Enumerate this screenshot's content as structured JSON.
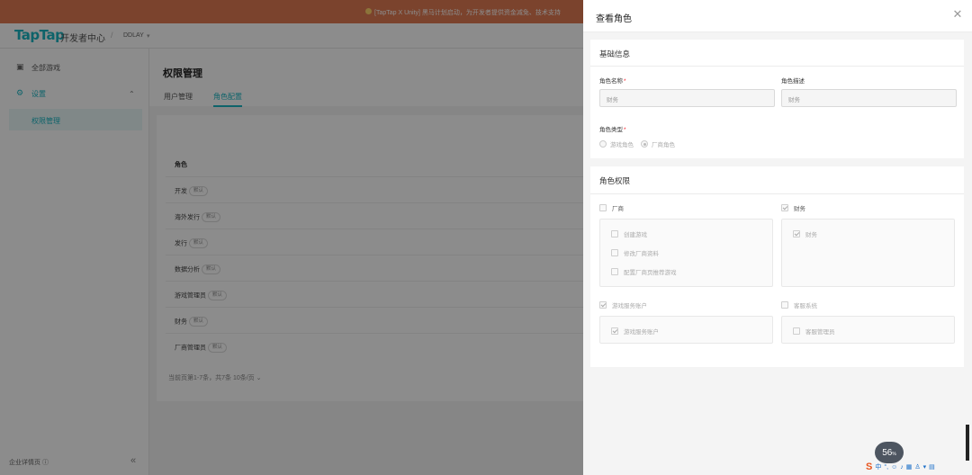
{
  "banner": {
    "text": "[TapTap X Unity] 黑马计划启动，为开发者提供资金减免、技术支持"
  },
  "topnav": {
    "logo": "TapTap",
    "logo_sub": "开发者中心",
    "separator": "/",
    "org": "DDLAY",
    "org_caret": "▾"
  },
  "sidebar": {
    "items": [
      {
        "label": "全部游戏",
        "icon": "gamepad-icon"
      },
      {
        "label": "设置",
        "icon": "gear-icon"
      }
    ],
    "sub_item": "权限管理",
    "footer": "企业详情页 ⓘ",
    "collapse": "«"
  },
  "page": {
    "title": "权限管理",
    "tabs": [
      {
        "label": "用户管理"
      },
      {
        "label": "角色配置"
      }
    ],
    "table_header": "角色",
    "rows": [
      {
        "name": "开发",
        "tag": "默认"
      },
      {
        "name": "海外发行",
        "tag": "默认"
      },
      {
        "name": "发行",
        "tag": "默认"
      },
      {
        "name": "数据分析",
        "tag": "默认"
      },
      {
        "name": "游戏管理员",
        "tag": "默认"
      },
      {
        "name": "财务",
        "tag": "默认"
      },
      {
        "name": "厂商管理员",
        "tag": "默认"
      }
    ],
    "pager": "当前页第1-7条，共7条  10条/页  ⌄"
  },
  "drawer": {
    "title": "查看角色",
    "close": "✕",
    "basic": {
      "title": "基础信息",
      "name_label": "角色名称",
      "name_value": "财务",
      "desc_label": "角色描述",
      "desc_value": "财务",
      "type_label": "角色类型",
      "required_mark": "*",
      "type_options": [
        "游戏角色",
        "厂商角色"
      ],
      "type_selected": "厂商角色"
    },
    "perm": {
      "title": "角色权限",
      "groups": [
        {
          "label": "厂商",
          "checked": false,
          "children": [
            "创建游戏",
            "修改厂商资料",
            "配置厂商页推荐游戏"
          ]
        },
        {
          "label": "财务",
          "checked": true,
          "children": [
            "财务"
          ]
        },
        {
          "label": "游戏服务账户",
          "checked": true,
          "children": [
            "游戏服务账户"
          ]
        },
        {
          "label": "客服系统",
          "checked": false,
          "children": [
            "客服管理员"
          ]
        }
      ]
    }
  },
  "tray": {
    "meter_value": "56",
    "meter_unit": "%",
    "ime": "S",
    "ime_lang": "中"
  }
}
